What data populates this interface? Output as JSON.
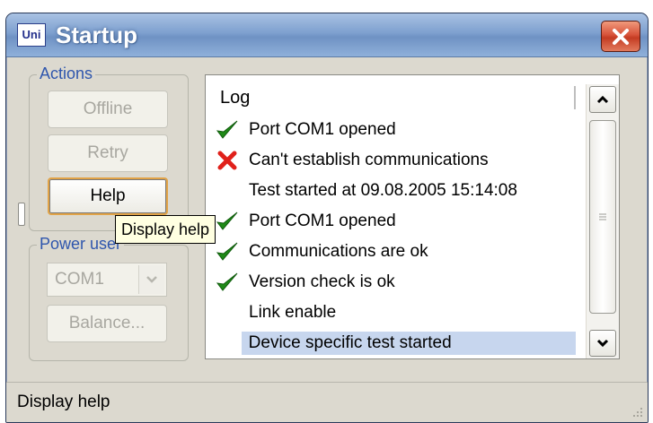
{
  "window": {
    "title": "Startup",
    "app_icon_text": "Uni"
  },
  "actions": {
    "group_label": "Actions",
    "offline_label": "Offline",
    "retry_label": "Retry",
    "help_label": "Help"
  },
  "power_user": {
    "group_label": "Power user",
    "port_value": "COM1",
    "balance_label": "Balance..."
  },
  "tooltip": {
    "text": "Display help"
  },
  "log": {
    "header": "Log",
    "rows": [
      {
        "icon": "check-icon",
        "text": "Port COM1 opened"
      },
      {
        "icon": "cross-icon",
        "text": "Can't establish communications"
      },
      {
        "icon": "",
        "text": "Test started at 09.08.2005 15:14:08"
      },
      {
        "icon": "check-icon",
        "text": "Port COM1 opened"
      },
      {
        "icon": "check-icon",
        "text": "Communications are ok"
      },
      {
        "icon": "check-icon",
        "text": "Version check is ok"
      },
      {
        "icon": "",
        "text": "Link enable"
      },
      {
        "icon": "",
        "text": "Device specific test started",
        "selected": true
      }
    ]
  },
  "status_bar": {
    "text": "Display help"
  },
  "colors": {
    "title_gradient_top": "#a9c2e3",
    "group_label": "#2f56ad",
    "close_button": "#c43b22",
    "check": "#1f8a17",
    "cross": "#e0201a",
    "selection": "#c7d6ee",
    "tooltip_bg": "#ffffe1"
  }
}
